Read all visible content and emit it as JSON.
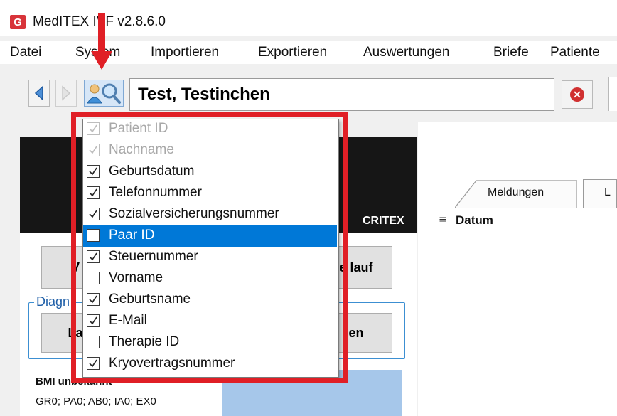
{
  "window": {
    "title": "MedITEX IVF v2.8.6.0",
    "logo_letter": "G"
  },
  "menu": {
    "items": [
      "Datei",
      "System",
      "Importieren",
      "Exportieren",
      "Auswertungen",
      "Briefe",
      "Patiente"
    ]
  },
  "toolbar": {
    "patient_name": "Test, Testinchen"
  },
  "dropdown": {
    "items": [
      {
        "label": "Patient ID",
        "checked": true,
        "disabled": true
      },
      {
        "label": "Nachname",
        "checked": true,
        "disabled": true
      },
      {
        "label": "Geburtsdatum",
        "checked": true,
        "disabled": false
      },
      {
        "label": "Telefonnummer",
        "checked": true,
        "disabled": false
      },
      {
        "label": "Sozialversicherungsnummer",
        "checked": true,
        "disabled": false
      },
      {
        "label": "Paar ID",
        "checked": false,
        "disabled": false,
        "selected": true
      },
      {
        "label": "Steuernummer",
        "checked": true,
        "disabled": false
      },
      {
        "label": "Vorname",
        "checked": false,
        "disabled": false
      },
      {
        "label": "Geburtsname",
        "checked": true,
        "disabled": false
      },
      {
        "label": "E-Mail",
        "checked": true,
        "disabled": false
      },
      {
        "label": "Therapie ID",
        "checked": false,
        "disabled": false
      },
      {
        "label": "Kryovertragsnummer",
        "checked": true,
        "disabled": false
      }
    ]
  },
  "left_panel": {
    "banner_text": "CRITEX",
    "buttons": {
      "top_left": "V",
      "top_right": "e lauf",
      "bottom_left": "La",
      "bottom_right": "en"
    },
    "group_label": "Diagn",
    "bmi_line1": "BMI unbekannt",
    "bmi_line2": "GR0; PA0; AB0; IA0; EX0"
  },
  "right_panel": {
    "tabs": [
      "Meldungen",
      "L"
    ],
    "column_header": "Datum"
  },
  "colors": {
    "annotation_red": "#e01f26",
    "selection_blue": "#0078d7",
    "accent_blue": "#3c8fd2"
  }
}
